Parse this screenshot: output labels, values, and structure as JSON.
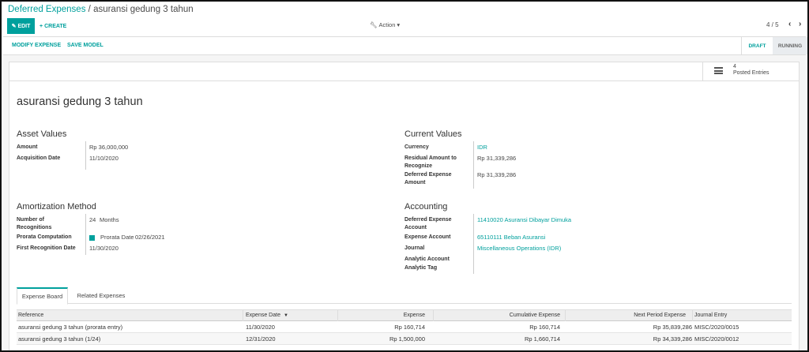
{
  "breadcrumb": {
    "parent": "Deferred Expenses",
    "separator": "/",
    "current": "asuransi gedung 3 tahun"
  },
  "toolbar": {
    "edit_label": "EDIT",
    "create_label": "CREATE",
    "action_label": "Action"
  },
  "pager": {
    "value": "4 / 5"
  },
  "statusbar": {
    "buttons": [
      "MODIFY EXPENSE",
      "SAVE MODEL"
    ],
    "stages": [
      "DRAFT",
      "RUNNING"
    ]
  },
  "stat_button": {
    "value": "4",
    "label": "Posted Entries"
  },
  "record": {
    "title": "asuransi gedung 3 tahun"
  },
  "asset_values": {
    "title": "Asset Values",
    "amount_label": "Amount",
    "amount": "Rp 36,000,000",
    "acquisition_label": "Acquisition Date",
    "acquisition": "11/10/2020"
  },
  "current_values": {
    "title": "Current Values",
    "currency_label": "Currency",
    "currency": "IDR",
    "residual_label_1": "Residual Amount to",
    "residual_label_2": "Recognize",
    "residual": "Rp 31,339,286",
    "deferred_label_1": "Deferred Expense",
    "deferred_label_2": "Amount",
    "deferred": "Rp 31,339,286"
  },
  "amortization": {
    "title": "Amortization Method",
    "recog_label_1": "Number of",
    "recog_label_2": "Recognitions",
    "recog": "24",
    "recog_unit": "Months",
    "prorata_label": "Prorata Computation",
    "prorata_date_label": "Prorata Date",
    "prorata_date": "02/26/2021",
    "first_label": "First Recognition Date",
    "first": "11/30/2020"
  },
  "accounting": {
    "title": "Accounting",
    "deferred_acc_label_1": "Deferred Expense",
    "deferred_acc_label_2": "Account",
    "deferred_acc": "11410020 Asuransi Dibayar Dimuka",
    "expense_acc_label": "Expense Account",
    "expense_acc": "65110111 Beban Asuransi",
    "journal_label": "Journal",
    "journal": "Miscellaneous Operations (IDR)",
    "analytic_label": "Analytic Account",
    "tag_label": "Analytic Tag"
  },
  "tabs": [
    "Expense Board",
    "Related Expenses"
  ],
  "table": {
    "headers": [
      "Reference",
      "Expense Date",
      "Expense",
      "Cumulative Expense",
      "Next Period Expense",
      "Journal Entry"
    ],
    "rows": [
      [
        "asuransi gedung 3 tahun (prorata entry)",
        "11/30/2020",
        "Rp 160,714",
        "Rp 160,714",
        "Rp 35,839,286",
        "MISC/2020/0015"
      ],
      [
        "asuransi gedung 3 tahun (1/24)",
        "12/31/2020",
        "Rp 1,500,000",
        "Rp 1,660,714",
        "Rp 34,339,286",
        "MISC/2020/0012"
      ]
    ]
  },
  "colors": {
    "accent": "#00a09d",
    "text": "#4c4c4c",
    "border": "#dddddd"
  }
}
